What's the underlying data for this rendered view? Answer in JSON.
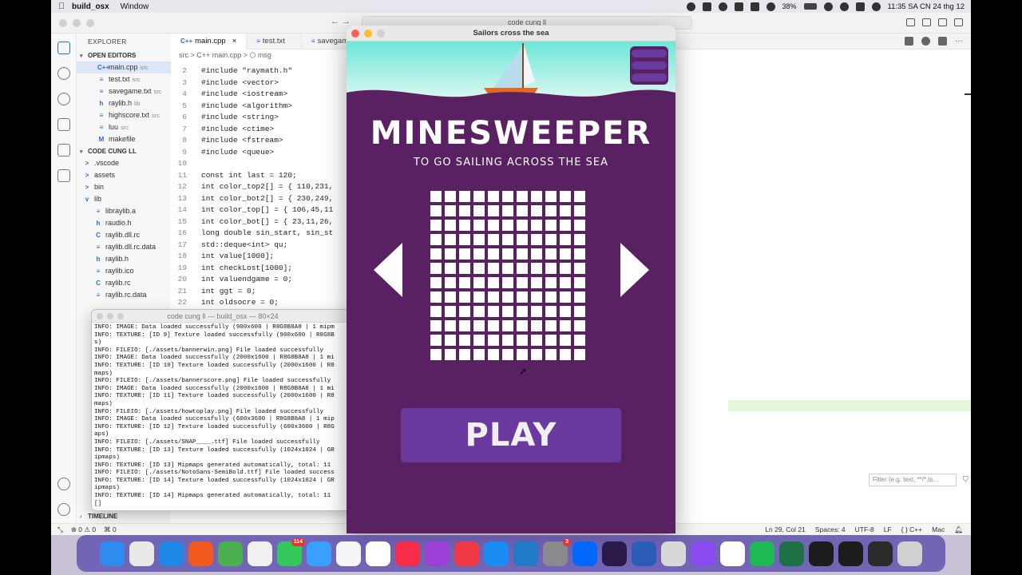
{
  "menubar": {
    "app_name": "build_osx",
    "menu": "Window",
    "clock": "11:35 SA CN 24 thg 12",
    "battery": "38%"
  },
  "vscode": {
    "search_placeholder": "code cung ll",
    "nav_arrows": "←   →",
    "sidebar": {
      "explorer_title": "EXPLORER",
      "open_editors_title": "OPEN EDITORS",
      "open_editors": [
        {
          "icon": "C++",
          "name": "main.cpp",
          "sub": "src"
        },
        {
          "icon": "≡",
          "name": "test.txt",
          "sub": "src"
        },
        {
          "icon": "≡",
          "name": "savegame.txt",
          "sub": "src"
        },
        {
          "icon": "h",
          "name": "raylib.h",
          "sub": "lib"
        },
        {
          "icon": "≡",
          "name": "highscore.txt",
          "sub": "src"
        },
        {
          "icon": "≡",
          "name": "luu",
          "sub": "src"
        },
        {
          "icon": "M",
          "name": "makefile",
          "sub": ""
        }
      ],
      "project_title": "CODE CUNG LL",
      "tree": [
        {
          "icon": ">",
          "name": ".vscode"
        },
        {
          "icon": ">",
          "name": "assets"
        },
        {
          "icon": ">",
          "name": "bin"
        },
        {
          "icon": "v",
          "name": "lib"
        },
        {
          "icon": "≡",
          "name": "libraylib.a"
        },
        {
          "icon": "h",
          "name": "raudio.h"
        },
        {
          "icon": "C",
          "name": "raylib.dll.rc"
        },
        {
          "icon": "≡",
          "name": "raylib.dll.rc.data"
        },
        {
          "icon": "h",
          "name": "raylib.h"
        },
        {
          "icon": "≡",
          "name": "raylib.ico"
        },
        {
          "icon": "C",
          "name": "raylib.rc"
        },
        {
          "icon": "≡",
          "name": "raylib.rc.data"
        }
      ],
      "timeline": "TIMELINE"
    },
    "tabs": [
      {
        "label": "main.cpp",
        "close": "×"
      },
      {
        "label": "test.txt",
        "close": ""
      },
      {
        "label": "savegam",
        "close": ""
      }
    ],
    "breadcrumb": "src  >  C++ main.cpp  >  ⬡ msg",
    "code_lines": [
      {
        "n": "2",
        "text": "#include \"raymath.h\""
      },
      {
        "n": "3",
        "text": "#include <vector>"
      },
      {
        "n": "4",
        "text": "#include <iostream>"
      },
      {
        "n": "5",
        "text": "#include <algorithm>"
      },
      {
        "n": "6",
        "text": "#include <string>"
      },
      {
        "n": "7",
        "text": "#include <ctime>"
      },
      {
        "n": "8",
        "text": "#include <fstream>"
      },
      {
        "n": "9",
        "text": "#include <queue>"
      },
      {
        "n": "10",
        "text": ""
      },
      {
        "n": "11",
        "text": "const int last = 120;"
      },
      {
        "n": "12",
        "text": "int color_top2[] = { 110,231,"
      },
      {
        "n": "13",
        "text": "int color_bot2[] = { 230,249,"
      },
      {
        "n": "14",
        "text": "int color_top[] = { 106,45,11"
      },
      {
        "n": "15",
        "text": "int color_bot[] = { 23,11,26,"
      },
      {
        "n": "16",
        "text": "long double sin_start, sin_st"
      },
      {
        "n": "17",
        "text": "std::deque<int> qu;"
      },
      {
        "n": "18",
        "text": "int value[1000];"
      },
      {
        "n": "19",
        "text": "int checkLost[1000];"
      },
      {
        "n": "20",
        "text": "int valuendgame = 0;"
      },
      {
        "n": "21",
        "text": "int ggt = 0;"
      },
      {
        "n": "22",
        "text": "int oldsocre = 0;"
      }
    ],
    "panel_filter_placeholder": "Filter (e.g. text, **/*.ts...",
    "status": {
      "errors": "⊗ 0  ⚠ 0",
      "ports": "⌘ 0",
      "position": "Ln 29, Col 21",
      "spaces": "Spaces: 4",
      "encoding": "UTF-8",
      "eol": "LF",
      "language": "{ } C++",
      "platform": "Mac"
    }
  },
  "terminal": {
    "title": "code cung ll — build_osx — 80×24",
    "lines": [
      "INFO: IMAGE: Data loaded successfully (900x600 | R8G8B8A8 | 1 mipm",
      "INFO: TEXTURE: [ID 9] Texture loaded successfully (900x600 | R8G8B",
      "s)",
      "INFO: FILEIO: [./assets/bannerwin.png] File loaded successfully",
      "INFO: IMAGE: Data loaded successfully (2000x1600 | R8G8B8A8 | 1 mi",
      "INFO: TEXTURE: [ID 10] Texture loaded successfully (2000x1600 | R8",
      "maps)",
      "INFO: FILEIO: [./assets/bannerscore.png] File loaded successfully",
      "INFO: IMAGE: Data loaded successfully (2000x1600 | R8G8B8A8 | 1 mi",
      "INFO: TEXTURE: [ID 11] Texture loaded successfully (2000x1600 | R8",
      "maps)",
      "INFO: FILEIO: [./assets/howtoplay.png] File loaded successfully",
      "INFO: IMAGE: Data loaded successfully (600x3600 | R8G8B8A8 | 1 mip",
      "INFO: TEXTURE: [ID 12] Texture loaded successfully (600x3600 | R8G",
      "aps)",
      "INFO: FILEIO: [./assets/SNAP____.ttf] File loaded successfully",
      "INFO: TEXTURE: [ID 13] Texture loaded successfully (1024x1024 | GR",
      "ipmaps)",
      "INFO: TEXTURE: [ID 13] Mipmaps generated automatically, total: 11",
      "INFO: FILEIO: [./assets/NotoSans-SemiBold.ttf] File loaded success",
      "INFO: TEXTURE: [ID 14] Texture loaded successfully (1024x1024 | GR",
      "ipmaps)",
      "INFO: TEXTURE: [ID 14] Mipmaps generated automatically, total: 11",
      "[]"
    ]
  },
  "game": {
    "window_title": "Sailors cross the sea",
    "logo": "MINESWEEPER",
    "subtitle": "TO GO SAILING ACROSS THE SEA",
    "grid_rows": 12,
    "grid_cols": 11,
    "play_label": "PLAY",
    "colors": {
      "background": "#5a2162",
      "sky_top": "#6ee7d8",
      "sky_bottom": "#e6f9f3",
      "play_button": "#6b3a9e",
      "boat": "#e36a1c"
    }
  },
  "dock": {
    "apps": [
      {
        "name": "finder-icon",
        "color": "#2e8cf0",
        "badge": ""
      },
      {
        "name": "launchpad-icon",
        "color": "#e9e9e9",
        "badge": ""
      },
      {
        "name": "safari-icon",
        "color": "#1e88e5",
        "badge": ""
      },
      {
        "name": "brave-icon",
        "color": "#f25a1d",
        "badge": ""
      },
      {
        "name": "coccoc-icon",
        "color": "#4caf50",
        "badge": ""
      },
      {
        "name": "chrome-icon",
        "color": "#f0f0f0",
        "badge": ""
      },
      {
        "name": "messages-icon",
        "color": "#34c759",
        "badge": "114"
      },
      {
        "name": "maps-icon",
        "color": "#3aa0ff",
        "badge": ""
      },
      {
        "name": "photos-icon",
        "color": "#f5f5f5",
        "badge": ""
      },
      {
        "name": "freeform-icon",
        "color": "#ffffff",
        "badge": ""
      },
      {
        "name": "music-icon",
        "color": "#fa2d48",
        "badge": ""
      },
      {
        "name": "podcasts-icon",
        "color": "#9b3fd6",
        "badge": ""
      },
      {
        "name": "news-icon",
        "color": "#f03a47",
        "badge": ""
      },
      {
        "name": "appstore-icon",
        "color": "#1c8cf5",
        "badge": ""
      },
      {
        "name": "vscode-icon",
        "color": "#1f7ac7",
        "badge": ""
      },
      {
        "name": "settings-icon",
        "color": "#8a8a8e",
        "badge": "3"
      },
      {
        "name": "zalo-icon",
        "color": "#0068ff",
        "badge": ""
      },
      {
        "name": "premiere-icon",
        "color": "#2a1a4a",
        "badge": ""
      },
      {
        "name": "word-icon",
        "color": "#2b5cb8",
        "badge": ""
      },
      {
        "name": "preview-icon",
        "color": "#d8d8d8",
        "badge": ""
      },
      {
        "name": "messenger-icon",
        "color": "#8a4cf0",
        "badge": ""
      },
      {
        "name": "notion-icon",
        "color": "#ffffff",
        "badge": ""
      },
      {
        "name": "spotify-icon",
        "color": "#1db954",
        "badge": ""
      },
      {
        "name": "excel-icon",
        "color": "#1e7145",
        "badge": ""
      },
      {
        "name": "terminal-icon",
        "color": "#1c1c1c",
        "badge": ""
      },
      {
        "name": "activity-monitor-icon",
        "color": "#1c1c1c",
        "badge": ""
      },
      {
        "name": "console-icon",
        "color": "#2b2b2b",
        "badge": ""
      },
      {
        "name": "trash-icon",
        "color": "#d0d0d0",
        "badge": ""
      }
    ]
  }
}
